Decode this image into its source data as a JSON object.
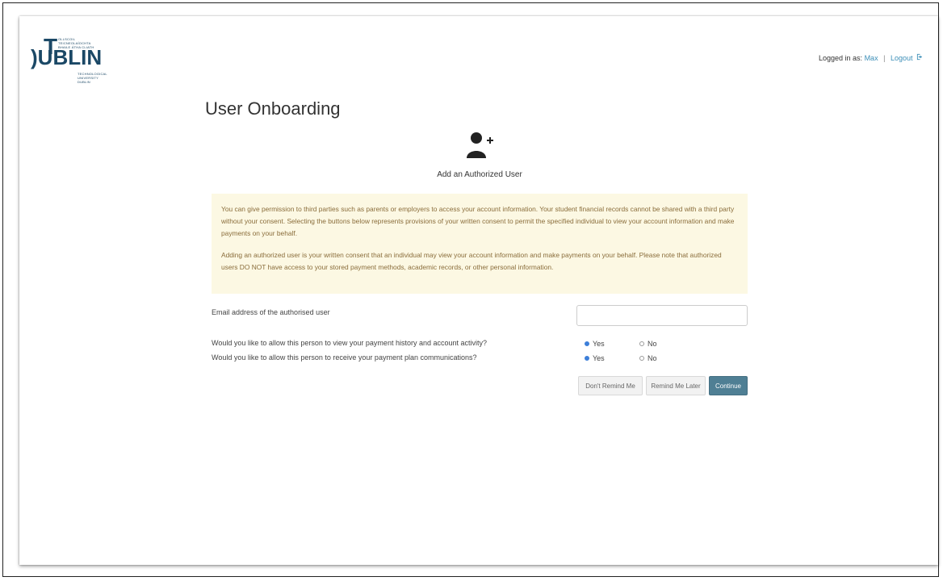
{
  "logo": {
    "main": "UBLIN",
    "prefix": ")",
    "t_letter": "T",
    "tagline_top": "OLLSCOIL TEICNEOLAÍOCHTA BHAILE ÁTHA CLIATH",
    "tagline_bottom": "TECHNOLOGICAL UNIVERSITY DUBLIN"
  },
  "header": {
    "logged_in_prefix": "Logged in as: ",
    "username": "Max",
    "separator": "|",
    "logout_label": "Logout",
    "logout_icon": "logout-icon"
  },
  "page": {
    "title": "User Onboarding",
    "add_user_icon": "add-user-icon",
    "add_user_label": "Add an Authorized User"
  },
  "notice": {
    "paragraph1": "You can give permission to third parties such as parents or employers to access your account information. Your student financial records cannot be shared with a third party without your consent. Selecting the buttons below represents provisions of your written consent to permit the specified individual to view your account information and make payments on your behalf.",
    "paragraph2": "Adding an authorized user is your written consent that an individual may view your account information and make payments on your behalf. Please note that authorized users DO NOT have access to your stored payment methods, academic records, or other personal information."
  },
  "form": {
    "email_label": "Email address of the authorised user",
    "email_value": "",
    "question1": "Would you like to allow this person to view your payment history and account activity?",
    "question2": "Would you like to allow this person to receive your payment plan communications?",
    "yes_label": "Yes",
    "no_label": "No",
    "q1_selected": "Yes",
    "q2_selected": "Yes"
  },
  "buttons": {
    "dont_remind": "Don't Remind Me",
    "remind_later": "Remind Me Later",
    "continue": "Continue"
  },
  "colors": {
    "notice_bg": "#fcf8e3",
    "notice_text": "#8a6d3b",
    "primary_button": "#4f7f94",
    "link": "#3d8fb8",
    "brand": "#1b4866"
  }
}
